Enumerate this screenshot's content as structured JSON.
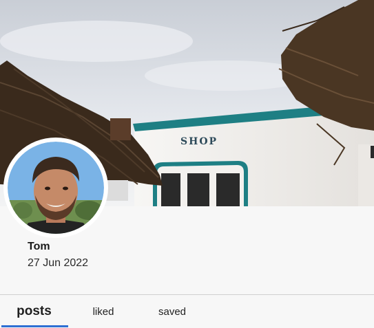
{
  "profile": {
    "name": "Tom",
    "date": "27 Jun 2022"
  },
  "cover": {
    "sign_text": "SHOP",
    "sky_color": "#dfe4ea",
    "wall_color": "#f2f0ee",
    "trim_color": "#1e7f84",
    "thatch_color": "#3a2a1c"
  },
  "tabs": [
    {
      "label": "posts",
      "selected": true
    },
    {
      "label": "liked",
      "selected": false
    },
    {
      "label": "saved",
      "selected": false
    }
  ],
  "colors": {
    "accent": "#2d6fd3",
    "background": "#f7f7f7"
  }
}
